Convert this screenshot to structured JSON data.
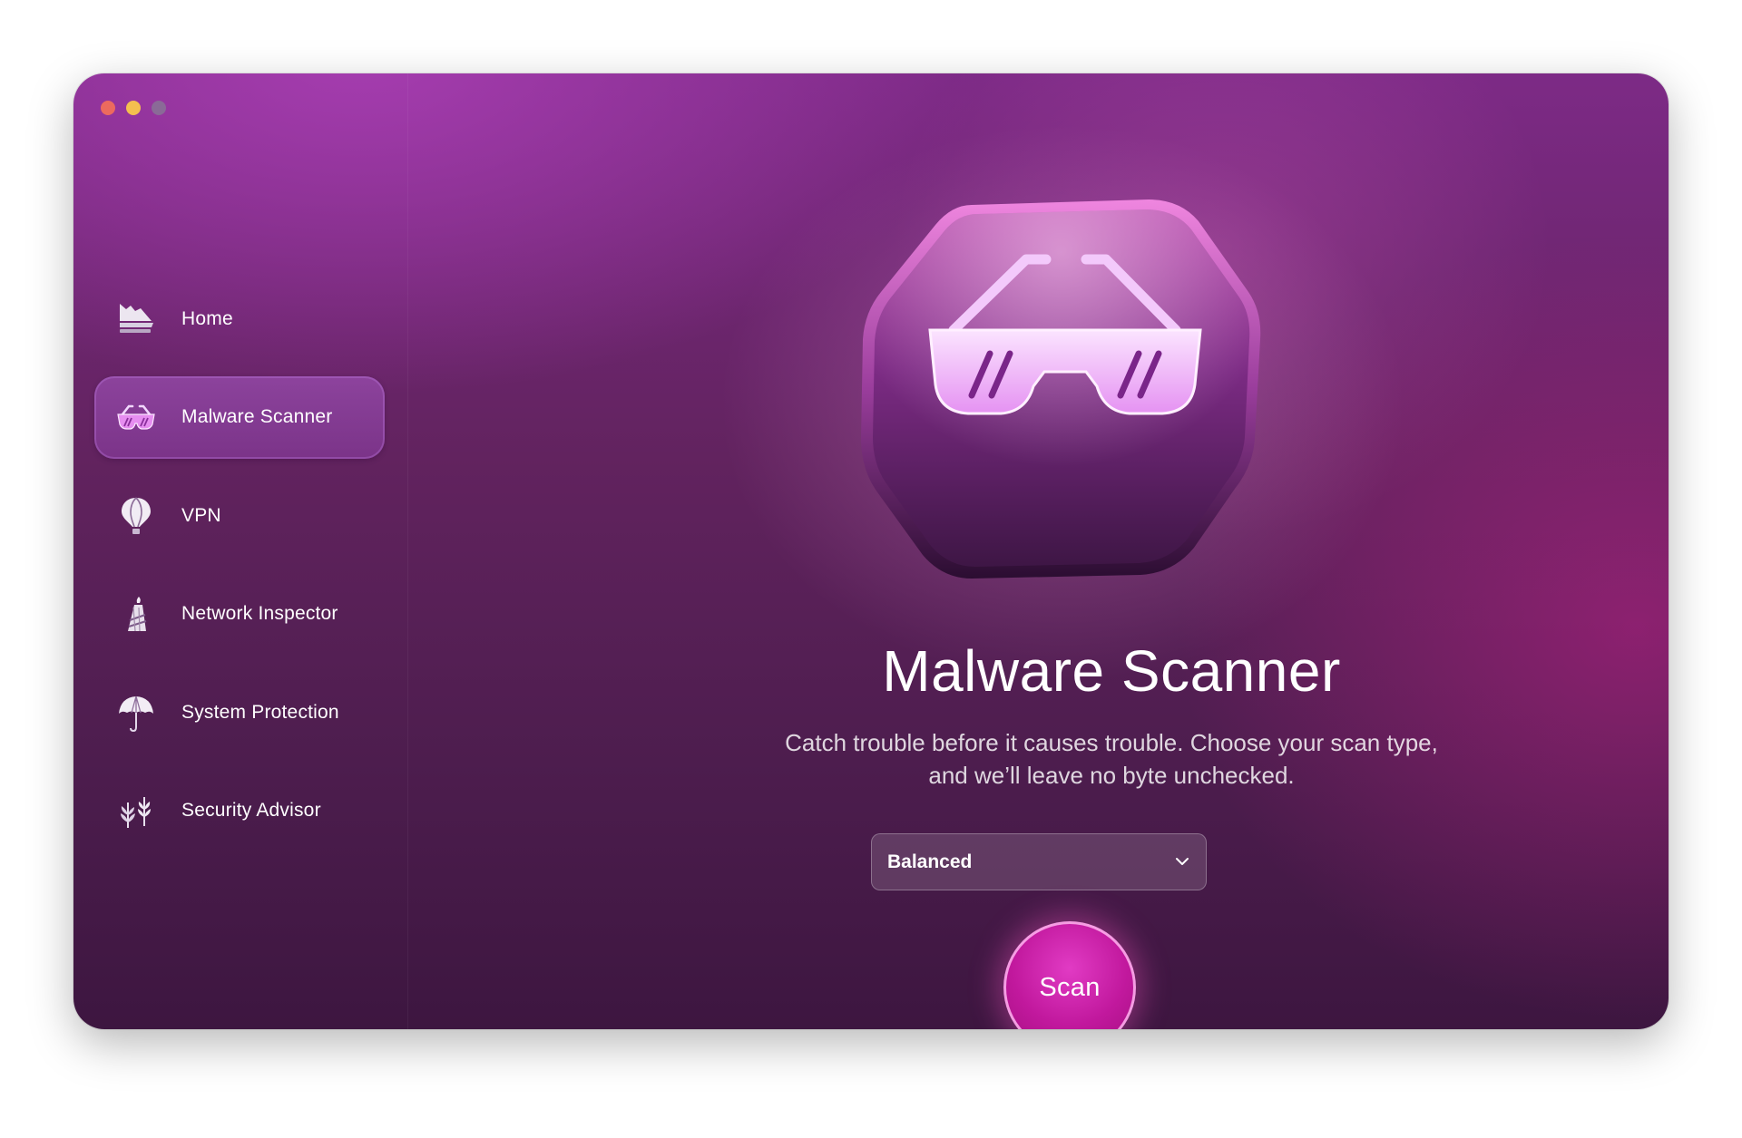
{
  "window": {
    "traffic_lights": [
      {
        "name": "close",
        "color": "#ec6a5e"
      },
      {
        "name": "minimize",
        "color": "#f4bf4f"
      },
      {
        "name": "zoom",
        "color": "#8a6a97"
      }
    ]
  },
  "sidebar": {
    "items": [
      {
        "label": "Home",
        "icon": "home-icon",
        "active": false
      },
      {
        "label": "Malware Scanner",
        "icon": "sunglasses-icon",
        "active": true
      },
      {
        "label": "VPN",
        "icon": "hot-air-balloon-icon",
        "active": false
      },
      {
        "label": "Network Inspector",
        "icon": "lighthouse-icon",
        "active": false
      },
      {
        "label": "System Protection",
        "icon": "umbrella-icon",
        "active": false
      },
      {
        "label": "Security Advisor",
        "icon": "plants-icon",
        "active": false
      }
    ]
  },
  "main": {
    "hero_icon": "sunglasses-octagon-icon",
    "title": "Malware Scanner",
    "subtitle_line1": "Catch trouble before it causes trouble. Choose your scan type,",
    "subtitle_line2": "and we’ll leave no byte unchecked.",
    "scan_type": {
      "selected": "Balanced"
    },
    "scan_button": "Scan"
  },
  "colors": {
    "accent": "#c1189d",
    "window_top": "#7d2a86",
    "window_bottom": "#3d1640"
  }
}
